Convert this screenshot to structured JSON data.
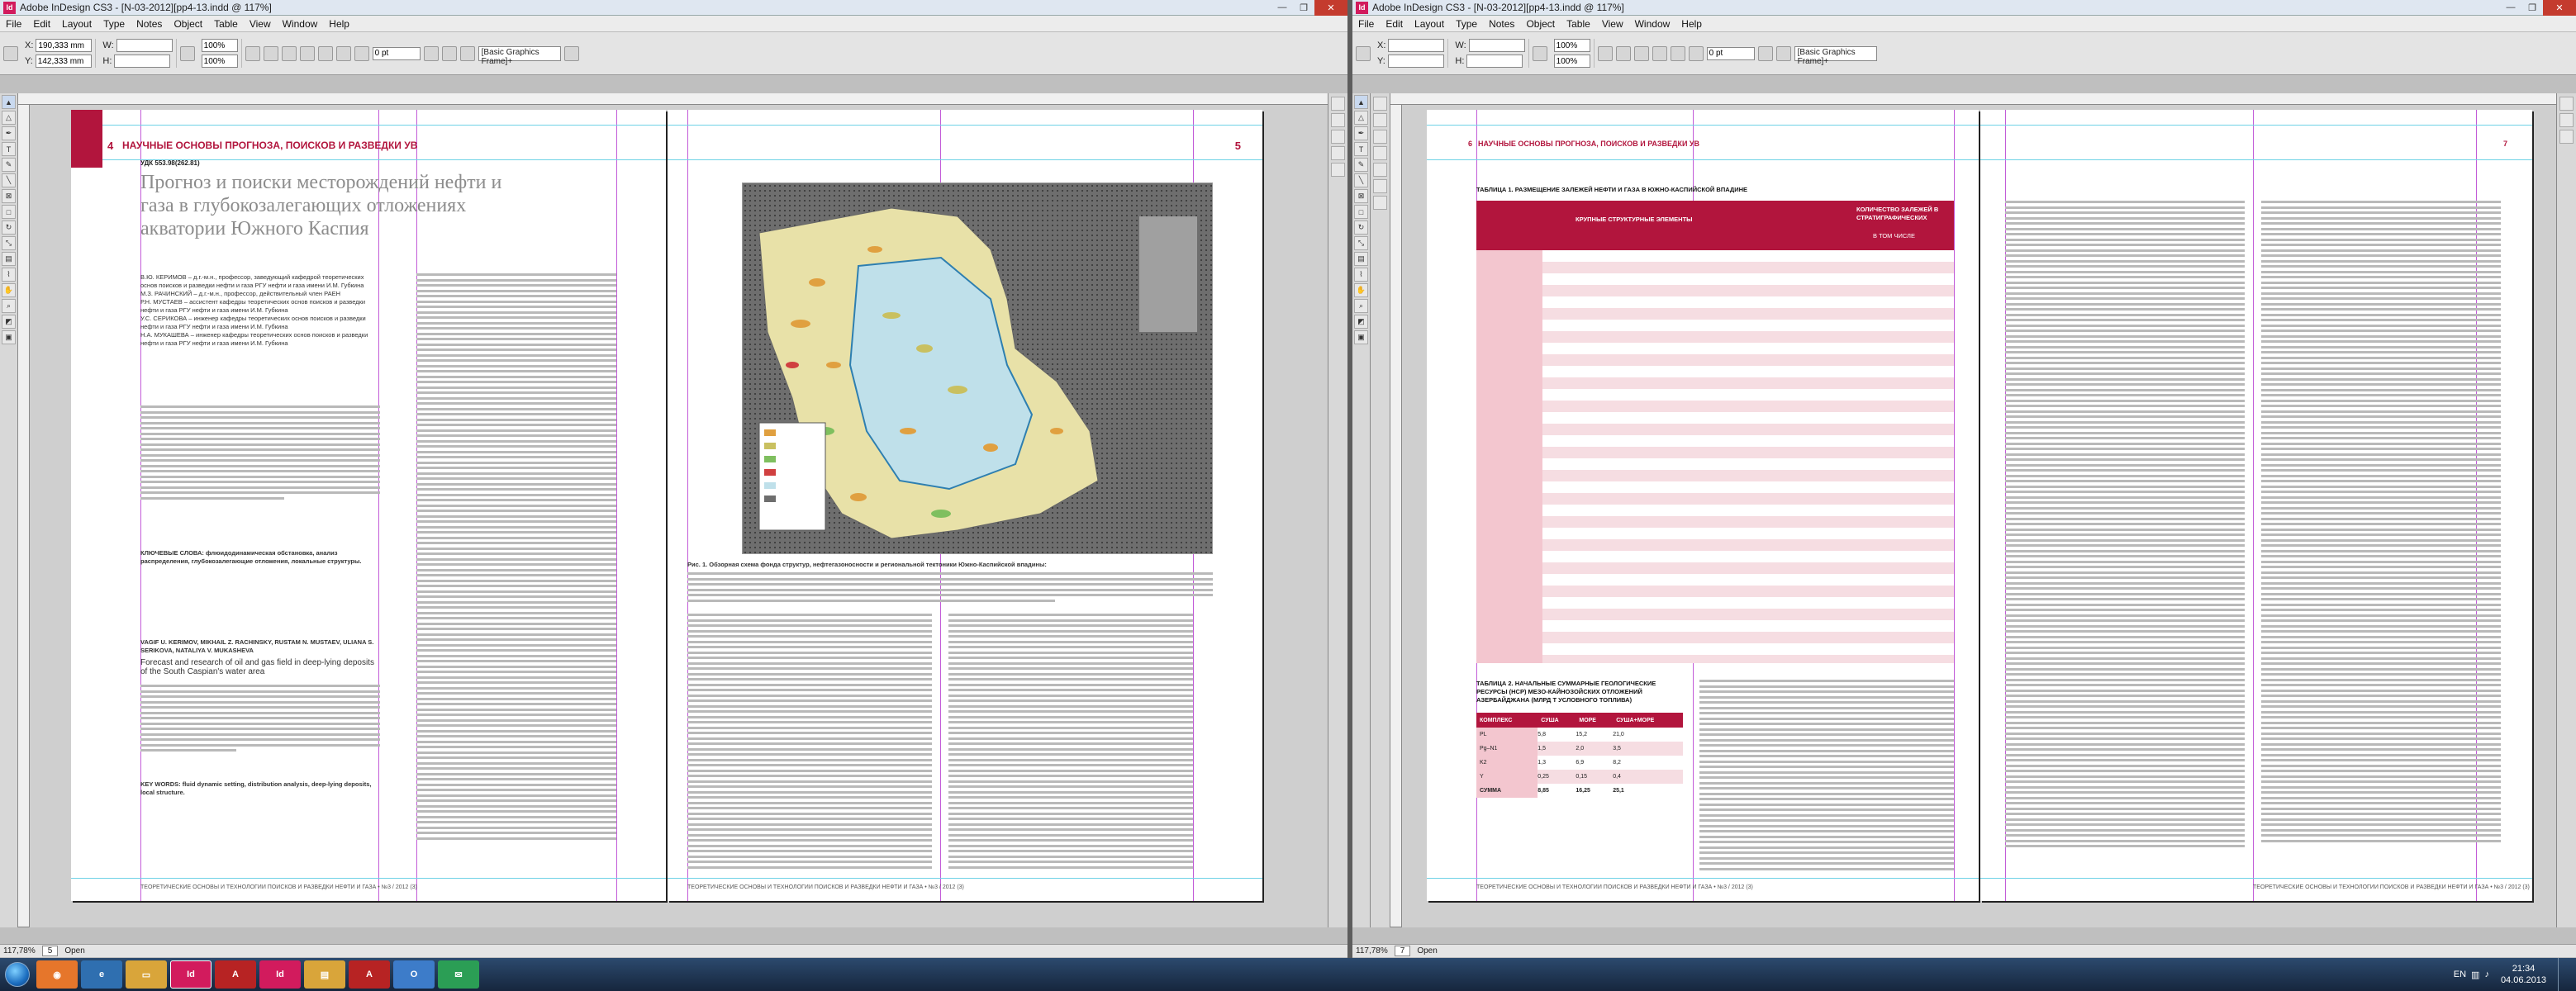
{
  "left_window": {
    "title": "Adobe InDesign CS3 - [N-03-2012][pp4-13.indd @ 117%]",
    "menu": [
      "File",
      "Edit",
      "Layout",
      "Type",
      "Notes",
      "Object",
      "Table",
      "View",
      "Window",
      "Help"
    ],
    "ctrl": {
      "x_label": "X:",
      "x_value": "190,333 mm",
      "y_label": "Y:",
      "y_value": "142,333 mm",
      "w_label": "W:",
      "h_label": "H:",
      "zoom1": "100%",
      "zoom2": "100%",
      "stroke": "0 pt",
      "frame_style": "[Basic Graphics Frame]+"
    },
    "status": {
      "zoom": "117,78%",
      "page": "5",
      "open": "Open"
    }
  },
  "right_window": {
    "title": "Adobe InDesign CS3 - [N-03-2012][pp4-13.indd @ 117%]",
    "menu": [
      "File",
      "Edit",
      "Layout",
      "Type",
      "Notes",
      "Object",
      "Table",
      "View",
      "Window",
      "Help"
    ],
    "ctrl": {
      "x_label": "X:",
      "y_label": "Y:",
      "w_label": "W:",
      "h_label": "H:",
      "zoom1": "100%",
      "zoom2": "100%",
      "stroke": "0 pt",
      "frame_style": "[Basic Graphics Frame]+"
    },
    "status": {
      "zoom": "117,78%",
      "page": "7",
      "open": "Open"
    }
  },
  "spread_left": {
    "page_num_left": "4",
    "page_num_right": "5",
    "running_head": "НАУЧНЫЕ ОСНОВЫ ПРОГНОЗА, ПОИСКОВ И РАЗВЕДКИ УВ",
    "udk": "УДК 553.98(262.81)",
    "article_title": "Прогноз и поиски месторождений нефти и газа в глубокозалегающих отложениях акватории Южного Каспия",
    "authors": "В.Ю. КЕРИМОВ – д.г.-м.н., профессор, заведующий кафедрой теоретических основ поисков и разведки нефти и газа РГУ нефти и газа имени И.М. Губкина\nМ.З. РАЧИНСКИЙ – д.г.-м.н., профессор, действительный член РАЕН\nР.Н. МУСТАЕВ – ассистент кафедры теоретических основ поисков и разведки нефти и газа РГУ нефти и газа имени И.М. Губкина\nУ.С. СЕРИКОВА – инженер кафедры теоретических основ поисков и разведки нефти и газа РГУ нефти и газа имени И.М. Губкина\nН.А. МУКАШЕВА – инженер кафедры теоретических основ поисков и разведки нефти и газа РГУ нефти и газа имени И.М. Губкина",
    "keywords_ru": "КЛЮЧЕВЫЕ СЛОВА: флюидодинамическая обстановка, анализ распределения, глубокозалегающие отложения, локальные структуры.",
    "authors_en": "VAGIF U. KERIMOV, MIKHAIL Z. RACHINSKY, RUSTAM N. MUSTAEV, ULIANA S. SERIKOVA, NATALIYA V. MUKASHEVA",
    "title_en": "Forecast and research of oil and gas field in deep-lying deposits of the South Caspian's water area",
    "keywords_en": "KEY WORDS: fluid dynamic setting, distribution analysis, deep-lying deposits, local structure.",
    "figure_caption": "Рис. 1. Обзорная схема фонда структур, нефтегазоносности и региональной тектоники Южно-Каспийской впадины:",
    "footer": "ТЕОРЕТИЧЕСКИЕ ОСНОВЫ И ТЕХНОЛОГИИ ПОИСКОВ И РАЗВЕДКИ НЕФТИ И ГАЗА • №3 / 2012 (3)"
  },
  "spread_right": {
    "page_num_left": "6",
    "page_num_right": "7",
    "running_head": "НАУЧНЫЕ ОСНОВЫ ПРОГНОЗА, ПОИСКОВ И РАЗВЕДКИ УВ",
    "table1_title": "ТАБЛИЦА 1. РАЗМЕЩЕНИЕ ЗАЛЕЖЕЙ НЕФТИ И ГАЗА В ЮЖНО-КАСПИЙСКОЙ ВПАДИНЕ",
    "table1_head": "КРУПНЫЕ СТРУКТУРНЫЕ ЭЛЕМЕНТЫ",
    "table1_head2": "КОЛИЧЕСТВО ЗАЛЕЖЕЙ В СТРАТИГРАФИЧЕСКИХ КОМПЛЕКСАХ",
    "table1_sub": "В ТОМ ЧИСЛЕ",
    "table2_title": "ТАБЛИЦА 2. НАЧАЛЬНЫЕ СУММАРНЫЕ ГЕОЛОГИЧЕСКИЕ РЕСУРСЫ (НСР) МЕЗО-КАЙНОЗОЙСКИХ ОТЛОЖЕНИЙ АЗЕРБАЙДЖАНА (МЛРД Т УСЛОВНОГО ТОПЛИВА)",
    "table2_cols": [
      "КОМПЛЕКС",
      "СУША",
      "МОРЕ",
      "СУША+МОРЕ"
    ],
    "table2_rows": [
      [
        "PL",
        "5,8",
        "15,2",
        "21,0"
      ],
      [
        "Pg–N1",
        "1,5",
        "2,0",
        "3,5"
      ],
      [
        "K2",
        "1,3",
        "6,9",
        "8,2"
      ],
      [
        "Y",
        "0,25",
        "0,15",
        "0,4"
      ],
      [
        "СУММА",
        "8,85",
        "16,25",
        "25,1"
      ]
    ],
    "footer": "ТЕОРЕТИЧЕСКИЕ ОСНОВЫ И ТЕХНОЛОГИИ ПОИСКОВ И РАЗВЕДКИ НЕФТИ И ГАЗА • №3 / 2012 (3)"
  },
  "taskbar": {
    "apps": [
      "Firefox",
      "Explorer",
      "Folder",
      "InDesign",
      "PDF",
      "InDesign",
      "Files",
      "Acrobat",
      "Outlook",
      "Email"
    ],
    "lang": "EN",
    "time": "21:34",
    "date": "04.06.2013"
  },
  "colors": {
    "accent": "#b2153d",
    "guide_magenta": "#c25bd8",
    "guide_cyan": "#6fd2e6",
    "table_red": "#b2153d",
    "table_pink": "#f3c6cf"
  }
}
